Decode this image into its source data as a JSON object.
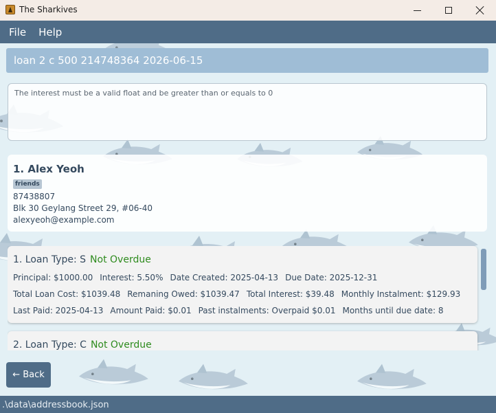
{
  "window": {
    "title": "The Sharkives"
  },
  "menu": [
    "File",
    "Help"
  ],
  "command": {
    "text": "loan 2 c 500 214748364 2026-06-15"
  },
  "result": {
    "message": "The interest must be a valid float and be greater than or equals to 0"
  },
  "person": {
    "index_name": "1.  Alex Yeoh",
    "tags": [
      "friends"
    ],
    "phone": "87438807",
    "address": "Blk 30 Geylang Street 29, #06-40",
    "email": "alexyeoh@example.com"
  },
  "loans": [
    {
      "title": "1. Loan Type: S",
      "status": "Not Overdue",
      "row1": [
        "Principal: $1000.00",
        "Interest: 5.50%",
        "Date Created: 2025-04-13",
        "Due Date: 2025-12-31"
      ],
      "row2": [
        "Total Loan Cost: $1039.48",
        "Remaning Owed: $1039.47",
        "Total Interest: $39.48",
        "Monthly Instalment: $129.93"
      ],
      "row3": [
        "Last Paid: 2025-04-13",
        "Amount Paid: $0.01",
        "Past instalments: Overpaid $0.01",
        "Months until due date: 8"
      ]
    },
    {
      "title": "2. Loan Type: C",
      "status": "Not Overdue"
    }
  ],
  "back_button": "← Back",
  "status_bar": {
    "path": ".\\data\\addressbook.json"
  },
  "colors": {
    "menubar": "#4f6c87",
    "command_box": "#9fbdd6",
    "status_ok": "#2e8b1e",
    "text_dark": "#34495e"
  }
}
